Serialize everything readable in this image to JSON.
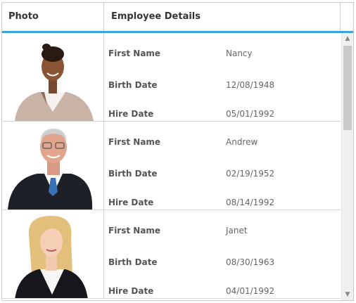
{
  "header": {
    "photo": "Photo",
    "details": "Employee Details"
  },
  "labels": {
    "first_name": "First Name",
    "birth_date": "Birth Date",
    "hire_date": "Hire Date"
  },
  "employees": [
    {
      "first_name": "Nancy",
      "birth_date": "12/08/1948",
      "hire_date": "05/01/1992"
    },
    {
      "first_name": "Andrew",
      "birth_date": "02/19/1952",
      "hire_date": "08/14/1992"
    },
    {
      "first_name": "Janet",
      "birth_date": "08/30/1963",
      "hire_date": "04/01/1992"
    }
  ],
  "scrollbar": {
    "up_icon": "chevron-up-icon",
    "down_icon": "chevron-down-icon"
  },
  "colors": {
    "header_underline": "#3aa3dc"
  }
}
